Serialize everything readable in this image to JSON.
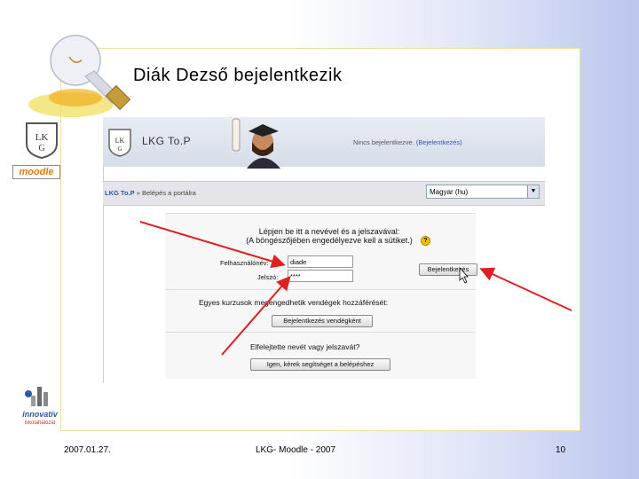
{
  "slide": {
    "title": "Diák Dezső bejelentkezik",
    "footer": {
      "date": "2007.01.27.",
      "center": "LKG- Moodle - 2007",
      "page_number": "10"
    }
  },
  "side_logos": {
    "moodle": "moodle",
    "innovativ": "innovatív",
    "innovativ_sub": "iskolahálózat"
  },
  "embedded_page": {
    "header": {
      "title": "LKG To.P",
      "status_text": "Nincs bejelentkezve.",
      "status_link": "(Bejelentkezés)"
    },
    "breadcrumb": {
      "home": "LKG To.P",
      "separator": "»",
      "current": "Belépés a portálra"
    },
    "language": {
      "selected": "Magyar (hu)"
    },
    "login": {
      "prompt_line1": "Lépjen be itt a nevével és a jelszavával:",
      "prompt_line2": "(A böngészőjében engedélyezve kell a sütiket.)",
      "username_label": "Felhasználónév:",
      "username_value": "diade",
      "password_label": "Jelszó:",
      "password_value": "****",
      "login_button": "Bejelentkezés",
      "guest_text": "Egyes kurzusok megengedhetik vendégek hozzáférését:",
      "guest_button": "Bejelentkezés vendégként",
      "forgot_text": "Elfelejtette nevét vagy jelszavát?",
      "forgot_button": "Igen, kérek segítséget a belépéshez"
    }
  },
  "colors": {
    "arrow": "#e02020",
    "frame_border": "#f2dca0",
    "link": "#3355aa"
  }
}
